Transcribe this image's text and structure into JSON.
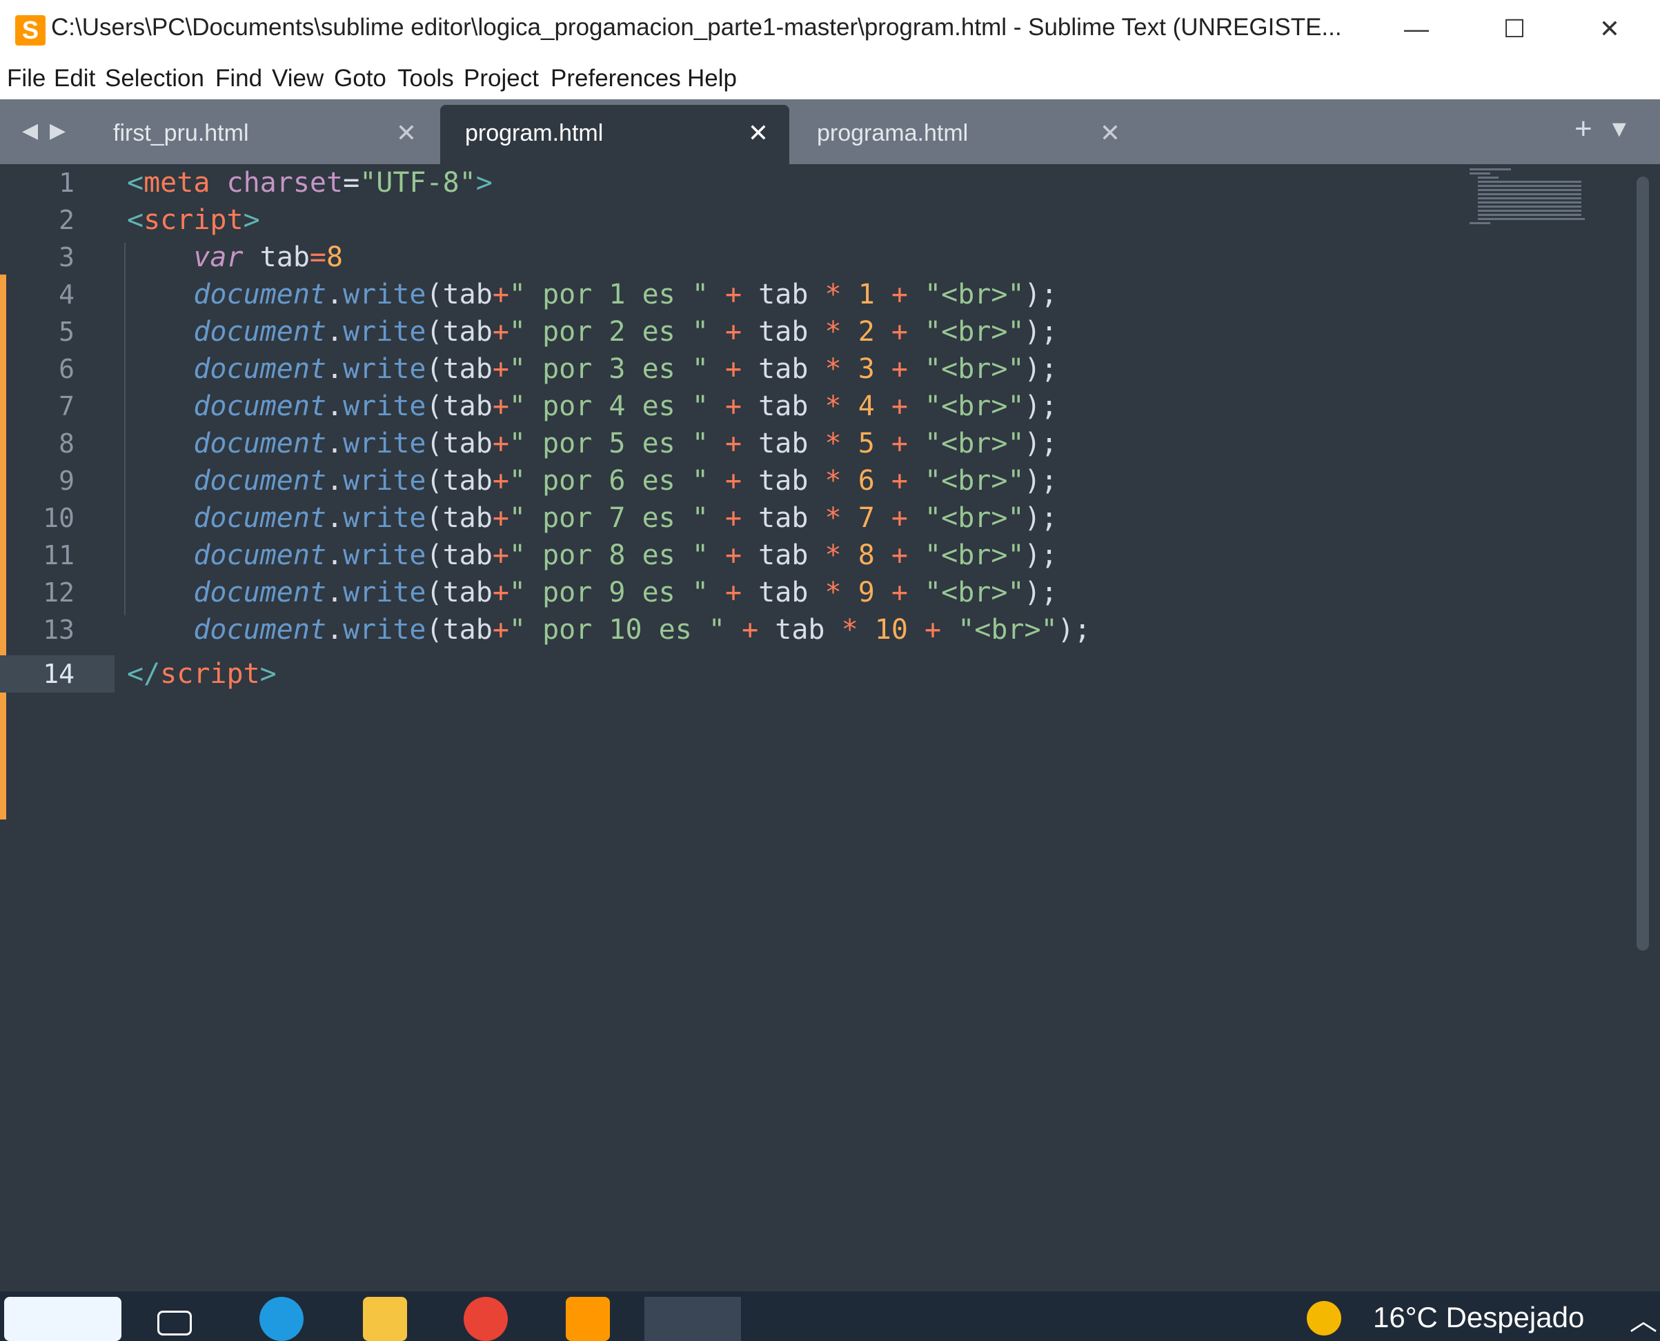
{
  "window": {
    "title": "C:\\Users\\PC\\Documents\\sublime editor\\logica_progamacion_parte1-master\\program.html - Sublime Text (UNREGISTE...",
    "minimize": "—",
    "maximize": "☐",
    "close": "✕"
  },
  "menu": [
    "File",
    "Edit",
    "Selection",
    "Find",
    "View",
    "Goto",
    "Tools",
    "Project",
    "Preferences",
    "Help"
  ],
  "tabs": [
    {
      "label": "first_pru.html",
      "close": "✕",
      "active": false
    },
    {
      "label": "program.html",
      "close": "✕",
      "active": true
    },
    {
      "label": "programa.html",
      "close": "✕",
      "active": false
    }
  ],
  "tab_controls": {
    "prev": "◀",
    "next": "▶",
    "new": "+",
    "menu": "▼"
  },
  "line_numbers": [
    "1",
    "2",
    "3",
    "4",
    "5",
    "6",
    "7",
    "8",
    "9",
    "10",
    "11",
    "12",
    "13",
    "14"
  ],
  "current_line": "14",
  "code": {
    "l1": [
      "<",
      "meta",
      " ",
      "charset",
      "=",
      "\"UTF-8\"",
      ">"
    ],
    "l2": [
      "<",
      "script",
      ">"
    ],
    "l3": [
      "    ",
      "var",
      " tab",
      "=",
      "8"
    ],
    "doc_lines": [
      {
        "obj": "document",
        "dot": ".",
        "fn": "write",
        "open": "(tab",
        "plus1": "+",
        "str": "\" por 1 es \"",
        "sp": " ",
        "plus2": "+",
        "tab": " tab ",
        "mul": "*",
        "n": " 1 ",
        "plus3": "+",
        "br": " \"<br>\"",
        "end": ");"
      },
      {
        "obj": "document",
        "dot": ".",
        "fn": "write",
        "open": "(tab",
        "plus1": "+",
        "str": "\" por 2 es \"",
        "sp": " ",
        "plus2": "+",
        "tab": " tab ",
        "mul": "*",
        "n": " 2 ",
        "plus3": "+",
        "br": " \"<br>\"",
        "end": ");"
      },
      {
        "obj": "document",
        "dot": ".",
        "fn": "write",
        "open": "(tab",
        "plus1": "+",
        "str": "\" por 3 es \"",
        "sp": " ",
        "plus2": "+",
        "tab": " tab ",
        "mul": "*",
        "n": " 3 ",
        "plus3": "+",
        "br": " \"<br>\"",
        "end": ");"
      },
      {
        "obj": "document",
        "dot": ".",
        "fn": "write",
        "open": "(tab",
        "plus1": "+",
        "str": "\" por 4 es \"",
        "sp": " ",
        "plus2": "+",
        "tab": " tab ",
        "mul": "*",
        "n": " 4 ",
        "plus3": "+",
        "br": " \"<br>\"",
        "end": ");"
      },
      {
        "obj": "document",
        "dot": ".",
        "fn": "write",
        "open": "(tab",
        "plus1": "+",
        "str": "\" por 5 es \"",
        "sp": " ",
        "plus2": "+",
        "tab": " tab ",
        "mul": "*",
        "n": " 5 ",
        "plus3": "+",
        "br": " \"<br>\"",
        "end": ");"
      },
      {
        "obj": "document",
        "dot": ".",
        "fn": "write",
        "open": "(tab",
        "plus1": "+",
        "str": "\" por 6 es \"",
        "sp": " ",
        "plus2": "+",
        "tab": " tab ",
        "mul": "*",
        "n": " 6 ",
        "plus3": "+",
        "br": " \"<br>\"",
        "end": ");"
      },
      {
        "obj": "document",
        "dot": ".",
        "fn": "write",
        "open": "(tab",
        "plus1": "+",
        "str": "\" por 7 es \"",
        "sp": " ",
        "plus2": "+",
        "tab": " tab ",
        "mul": "*",
        "n": " 7 ",
        "plus3": "+",
        "br": " \"<br>\"",
        "end": ");"
      },
      {
        "obj": "document",
        "dot": ".",
        "fn": "write",
        "open": "(tab",
        "plus1": "+",
        "str": "\" por 8 es \"",
        "sp": " ",
        "plus2": "+",
        "tab": " tab ",
        "mul": "*",
        "n": " 8 ",
        "plus3": "+",
        "br": " \"<br>\"",
        "end": ");"
      },
      {
        "obj": "document",
        "dot": ".",
        "fn": "write",
        "open": "(tab",
        "plus1": "+",
        "str": "\" por 9 es \"",
        "sp": " ",
        "plus2": "+",
        "tab": " tab ",
        "mul": "*",
        "n": " 9 ",
        "plus3": "+",
        "br": " \"<br>\"",
        "end": ");"
      },
      {
        "obj": "document",
        "dot": ".",
        "fn": "write",
        "open": "(tab",
        "plus1": "+",
        "str": "\" por 10 es \"",
        "sp": " ",
        "plus2": "+",
        "tab": " tab ",
        "mul": "*",
        "n": " 10 ",
        "plus3": "+",
        "br": " \"<br>\"",
        "end": ");"
      }
    ],
    "l14": [
      "</",
      "script",
      ">"
    ]
  },
  "taskbar": {
    "weather": "16°C  Despejado",
    "chevron": "︿",
    "icons": [
      "widgets-icon",
      "task-view-icon",
      "edge-icon",
      "file-explorer-icon",
      "chrome-icon",
      "sublime-text-icon",
      "office-icon"
    ]
  },
  "colors": {
    "editor_bg": "#303841",
    "tabbar_bg": "#6b7480",
    "accent_orange": "#f9ae58",
    "string_green": "#99c794",
    "keyword_purple": "#c695c6",
    "object_blue": "#6699cc",
    "operator_red": "#f97b58"
  }
}
